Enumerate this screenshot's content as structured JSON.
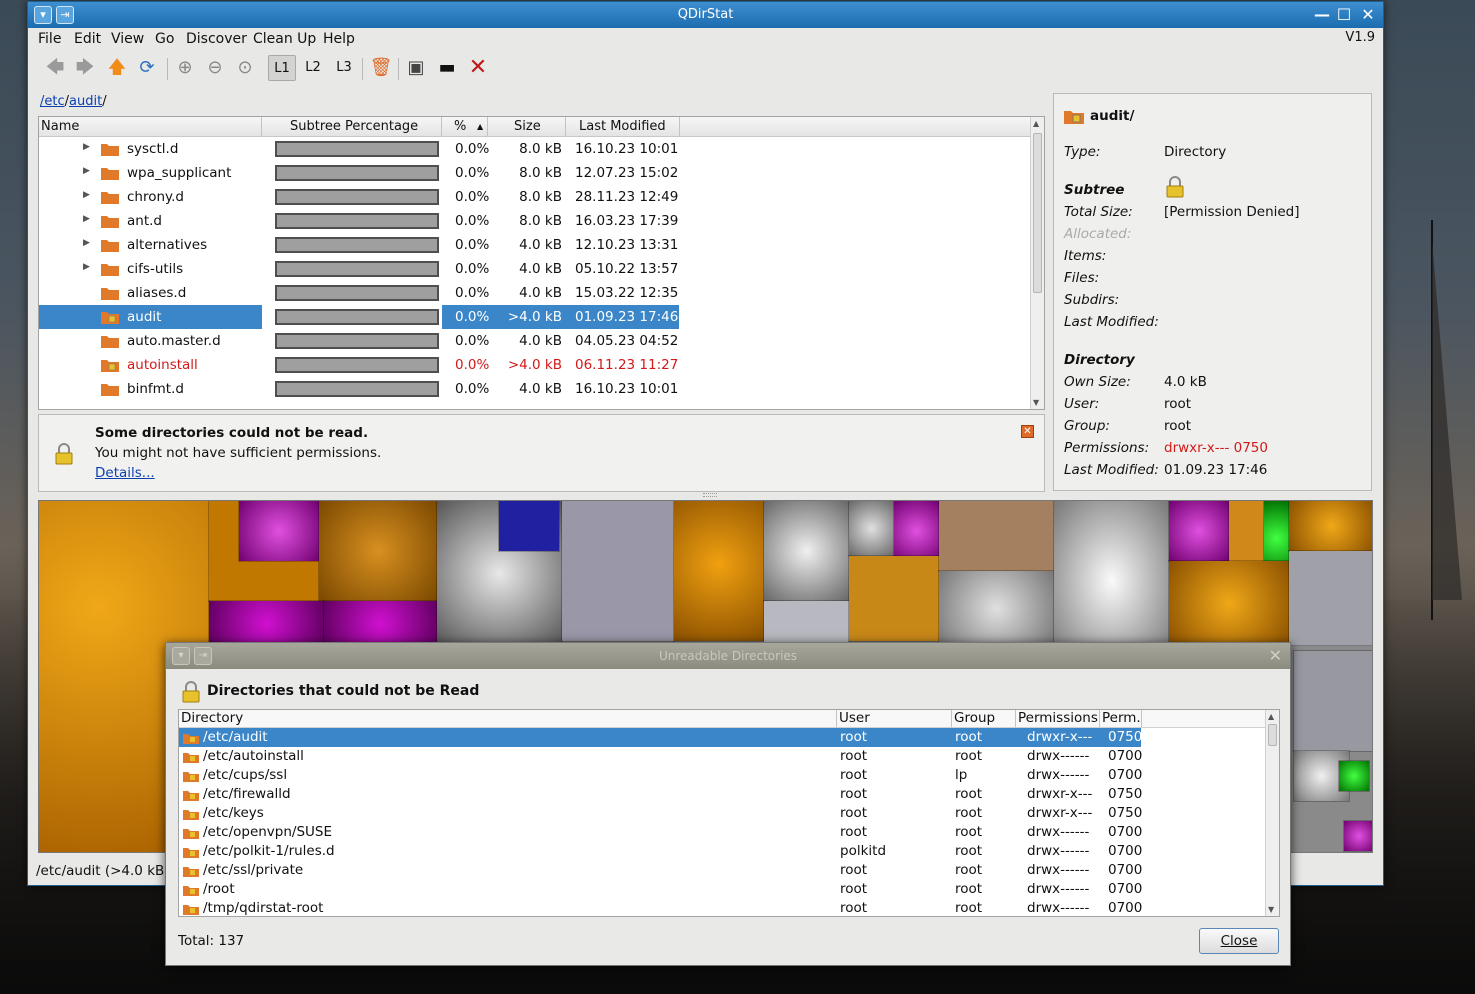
{
  "window": {
    "title": "QDirStat",
    "version": "V1.9"
  },
  "menu": [
    "File",
    "Edit",
    "View",
    "Go",
    "Discover",
    "Clean Up",
    "Help"
  ],
  "toolbar": {
    "levels": [
      "L1",
      "L2",
      "L3"
    ],
    "active_level": "L1"
  },
  "breadcrumb": {
    "part1": "/etc",
    "sep1": "/",
    "part2": "audit",
    "sep2": "/"
  },
  "tree": {
    "columns": [
      "Name",
      "Subtree Percentage",
      "%",
      "Size",
      "Last Modified"
    ],
    "rows": [
      {
        "name": "sysctl.d",
        "pct": "0.0%",
        "size": "8.0 kB",
        "modified": "16.10.23 10:01",
        "expandable": true
      },
      {
        "name": "wpa_supplicant",
        "pct": "0.0%",
        "size": "8.0 kB",
        "modified": "12.07.23 15:02",
        "expandable": true
      },
      {
        "name": "chrony.d",
        "pct": "0.0%",
        "size": "8.0 kB",
        "modified": "28.11.23 12:49",
        "expandable": true
      },
      {
        "name": "ant.d",
        "pct": "0.0%",
        "size": "8.0 kB",
        "modified": "16.03.23 17:39",
        "expandable": true
      },
      {
        "name": "alternatives",
        "pct": "0.0%",
        "size": "4.0 kB",
        "modified": "12.10.23 13:31",
        "expandable": true
      },
      {
        "name": "cifs-utils",
        "pct": "0.0%",
        "size": "4.0 kB",
        "modified": "05.10.22 13:57",
        "expandable": true
      },
      {
        "name": "aliases.d",
        "pct": "0.0%",
        "size": "4.0 kB",
        "modified": "15.03.22 12:35",
        "expandable": false
      },
      {
        "name": "audit",
        "pct": "0.0%",
        "size": ">4.0 kB",
        "modified": "01.09.23 17:46",
        "expandable": false,
        "selected": true,
        "locked": true
      },
      {
        "name": "auto.master.d",
        "pct": "0.0%",
        "size": "4.0 kB",
        "modified": "04.05.23 04:52",
        "expandable": false
      },
      {
        "name": "autoinstall",
        "pct": "0.0%",
        "size": ">4.0 kB",
        "modified": "06.11.23 11:27",
        "expandable": false,
        "red": true,
        "locked": true
      },
      {
        "name": "binfmt.d",
        "pct": "0.0%",
        "size": "4.0 kB",
        "modified": "16.10.23 10:01",
        "expandable": false
      }
    ]
  },
  "permission_panel": {
    "heading": "Some directories could not be read.",
    "subtext": "You might not have sufficient permissions.",
    "link": "Details..."
  },
  "details": {
    "name": "audit/",
    "type_label": "Type:",
    "type_value": "Directory",
    "subtree_heading": "Subtree",
    "total_size_label": "Total Size:",
    "total_size_value": "[Permission Denied]",
    "allocated_label": "Allocated:",
    "items_label": "Items:",
    "files_label": "Files:",
    "subdirs_label": "Subdirs:",
    "last_modified_label": "Last Modified:",
    "directory_heading": "Directory",
    "own_size_label": "Own Size:",
    "own_size_value": "4.0 kB",
    "user_label": "User:",
    "user_value": "root",
    "group_label": "Group:",
    "group_value": "root",
    "permissions_label": "Permissions:",
    "permissions_value": "drwxr-x---  0750",
    "dir_last_modified_label": "Last Modified:",
    "dir_last_modified_value": "01.09.23 17:46"
  },
  "statusbar": {
    "text": "/etc/audit  (>4.0 kB)"
  },
  "dialog": {
    "title": "Unreadable Directories",
    "heading": "Directories that could not be Read",
    "columns": [
      "Directory",
      "User",
      "Group",
      "Permissions",
      "Perm."
    ],
    "rows": [
      {
        "dir": "/etc/audit",
        "user": "root",
        "group": "root",
        "perms": "drwxr-x---",
        "perm": "0750",
        "selected": true
      },
      {
        "dir": "/etc/autoinstall",
        "user": "root",
        "group": "root",
        "perms": "drwx------",
        "perm": "0700"
      },
      {
        "dir": "/etc/cups/ssl",
        "user": "root",
        "group": "lp",
        "perms": "drwx------",
        "perm": "0700"
      },
      {
        "dir": "/etc/firewalld",
        "user": "root",
        "group": "root",
        "perms": "drwxr-x---",
        "perm": "0750"
      },
      {
        "dir": "/etc/keys",
        "user": "root",
        "group": "root",
        "perms": "drwxr-x---",
        "perm": "0750"
      },
      {
        "dir": "/etc/openvpn/SUSE",
        "user": "root",
        "group": "root",
        "perms": "drwx------",
        "perm": "0700"
      },
      {
        "dir": "/etc/polkit-1/rules.d",
        "user": "polkitd",
        "group": "root",
        "perms": "drwx------",
        "perm": "0700"
      },
      {
        "dir": "/etc/ssl/private",
        "user": "root",
        "group": "root",
        "perms": "drwx------",
        "perm": "0700"
      },
      {
        "dir": "/root",
        "user": "root",
        "group": "root",
        "perms": "drwx------",
        "perm": "0700"
      },
      {
        "dir": "/tmp/qdirstat-root",
        "user": "root",
        "group": "root",
        "perms": "drwx------",
        "perm": "0700"
      }
    ],
    "total": "Total: 137",
    "close_label": "Close"
  },
  "colors": {
    "selection": "#3a86c8",
    "titlebar": "#1c6db0",
    "error_red": "#d21a1a",
    "folder_orange": "#e07a2a"
  }
}
